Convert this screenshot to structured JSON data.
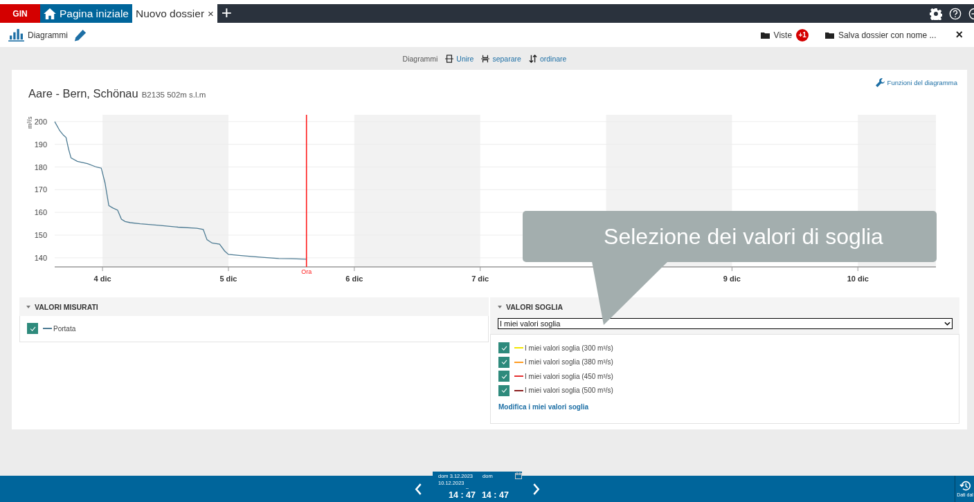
{
  "tabs": {
    "brand": "GIN",
    "items": [
      {
        "label": "Pagina iniziale",
        "kind": "home",
        "selected": false
      },
      {
        "label": "Nuovo dossier",
        "kind": "dossier",
        "selected": true,
        "close": "×"
      }
    ],
    "add": "+"
  },
  "toolbar": {
    "title": "Diagrammi",
    "views": {
      "label": "Viste",
      "badge": "+1"
    },
    "save": "Salva dossier con nome ...",
    "close": "×"
  },
  "diagram_tools": {
    "label": "Diagrammi",
    "actions": [
      {
        "label": "Unire",
        "kind": "join"
      },
      {
        "label": "separare",
        "kind": "split"
      },
      {
        "label": "ordinare",
        "kind": "sort"
      }
    ]
  },
  "chart_panel": {
    "link": "Funzioni del diagramma",
    "title": "Aare - Bern, Schönau",
    "subtitle": "B2135 502m  s.l.m",
    "chart_data": {
      "type": "line",
      "ylabel": "m³/s",
      "xlim": [
        3.62,
        10.62
      ],
      "ylim": [
        136,
        203
      ],
      "yticks": [
        140,
        150,
        160,
        170,
        180,
        190,
        200
      ],
      "xticks": [
        {
          "value": 4,
          "label": "4 dic"
        },
        {
          "value": 5,
          "label": "5 dic"
        },
        {
          "value": 6,
          "label": "6 dic"
        },
        {
          "value": 7,
          "label": "7 dic"
        },
        {
          "value": 9,
          "label": "9 dic"
        },
        {
          "value": 10,
          "label": "10 dic"
        }
      ],
      "x": [
        3.62,
        3.66,
        3.69,
        3.71,
        3.73,
        3.75,
        3.8,
        3.88,
        3.95,
        3.99,
        4.02,
        4.05,
        4.08,
        4.12,
        4.15,
        4.18,
        4.22,
        4.3,
        4.45,
        4.6,
        4.75,
        4.8,
        4.83,
        4.87,
        4.93,
        4.97,
        5.0,
        5.1,
        5.25,
        5.4,
        5.5,
        5.62
      ],
      "series": [
        {
          "name": "Portata",
          "color": "#4d7b93",
          "values": [
            200,
            196,
            194,
            193,
            188,
            184,
            182.5,
            181.5,
            180,
            179.5,
            173,
            163,
            162,
            161,
            157,
            156,
            155.5,
            155,
            154.3,
            153.5,
            153,
            152.5,
            148,
            146.5,
            146,
            143,
            141.5,
            141,
            140.3,
            139.7,
            139.6,
            139.4
          ]
        }
      ],
      "grid": true,
      "bands": [
        {
          "axis": "x",
          "from": 4,
          "to": 5,
          "color": "#f2f2f2"
        },
        {
          "axis": "x",
          "from": 6,
          "to": 7,
          "color": "#f2f2f2"
        },
        {
          "axis": "x",
          "from": 8,
          "to": 9,
          "color": "#f2f2f2"
        },
        {
          "axis": "x",
          "from": 10,
          "to": 10.62,
          "color": "#f2f2f2"
        }
      ],
      "ref_lines": [
        {
          "axis": "x",
          "value": 5.62,
          "label": "Ora",
          "color": "#ff1a1a"
        }
      ]
    }
  },
  "measured": {
    "title": "VALORI MISURATI",
    "expanded": true,
    "items": [
      {
        "checked": true
      }
    ]
  },
  "thresholds": {
    "title": "VALORI SOGLIA",
    "expanded": true,
    "select": "I miei valori soglia",
    "items": [
      {
        "label": "I miei valori soglia (300 m³/s)",
        "checked": true,
        "color": "#f2e600"
      },
      {
        "label": "I miei valori soglia (380 m³/s)",
        "checked": true,
        "color": "#ff9a1f"
      },
      {
        "label": "I miei valori soglia (450 m³/s)",
        "checked": true,
        "color": "#e53030"
      },
      {
        "label": "I miei valori soglia (500 m³/s)",
        "checked": true,
        "color": "#8a1c1c"
      }
    ],
    "edit_link": "Modifica i miei valori soglia"
  },
  "callout": {
    "text": "Selezione dei valori di soglia"
  },
  "timebar": {
    "from": "dom 3.12.2023",
    "to_day": "dom",
    "to_date": "10.12.2023",
    "separator": "–",
    "time_from": "14 : 47",
    "time_to": "14 : 47",
    "side": "Dati dal"
  }
}
